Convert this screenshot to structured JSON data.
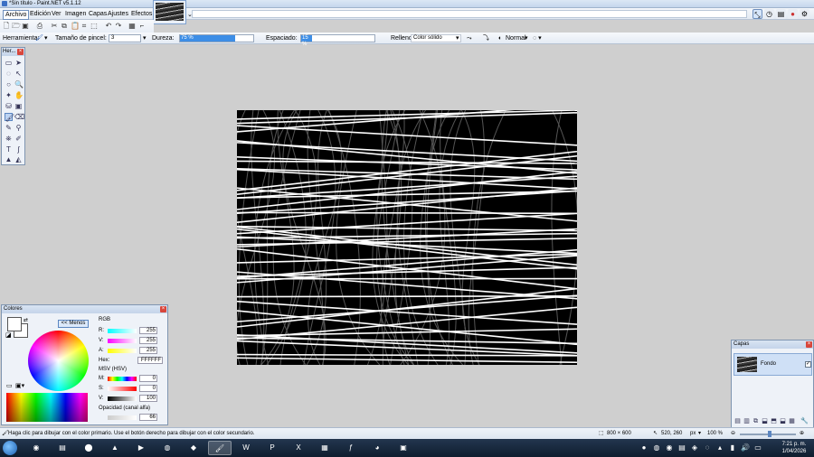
{
  "window": {
    "title": "*Sin título - Paint.NET v5.1.12"
  },
  "menu": {
    "items": [
      "Archivo",
      "Edición",
      "Ver",
      "Imagen",
      "Capas",
      "Ajustes",
      "Efectos"
    ]
  },
  "toolbar": {
    "herramienta_label": "Herramienta:",
    "brush_size_label": "Tamaño de pincel:",
    "brush_size_value": "3",
    "dureza_label": "Dureza:",
    "dureza_value": "75 %",
    "dureza_fraction": 0.75,
    "espaciado_label": "Espaciado:",
    "espaciado_value": "15 %",
    "espaciado_fraction": 0.15,
    "relleno_label": "Relleno:",
    "relleno_value": "Color sólido",
    "blend_value": "Normal"
  },
  "tools": {
    "title": "Her..."
  },
  "colors": {
    "title": "Colores",
    "menos_label": "<< Menos",
    "rgb_label": "RGB",
    "r_label": "R:",
    "r_value": "255",
    "g_label": "V:",
    "g_value": "255",
    "b_label": "A:",
    "b_value": "255",
    "hex_label": "Hex:",
    "hex_value": "FFFFFF",
    "hsv_label": "MSV (HSV)",
    "h_label": "M:",
    "h_value": "0",
    "s_label": "S:",
    "s_value": "0",
    "v_label": "V:",
    "v_value": "100",
    "alpha_label": "Opacidad (canal alfa)",
    "alpha_value": "66",
    "primary_color": "#FFFFFF",
    "secondary_color": "#FFFFFF"
  },
  "layers": {
    "title": "Capas",
    "layer_name": "Fondo",
    "visible": true
  },
  "status": {
    "hint": "Haga clic para dibujar con el color primario. Use el botón derecho para dibujar con el color secundario.",
    "image_size": "800 × 600",
    "cursor_pos": "520, 260",
    "units": "px",
    "zoom": "100 %"
  },
  "taskbar": {
    "time": "7:21 p. m.",
    "date": "1/04/2026"
  },
  "colors_palette": {
    "accent": "#3d8ee6",
    "canvas_bg": "#000000",
    "stroke_white": "#ffffff",
    "stroke_gray": "#555555"
  }
}
